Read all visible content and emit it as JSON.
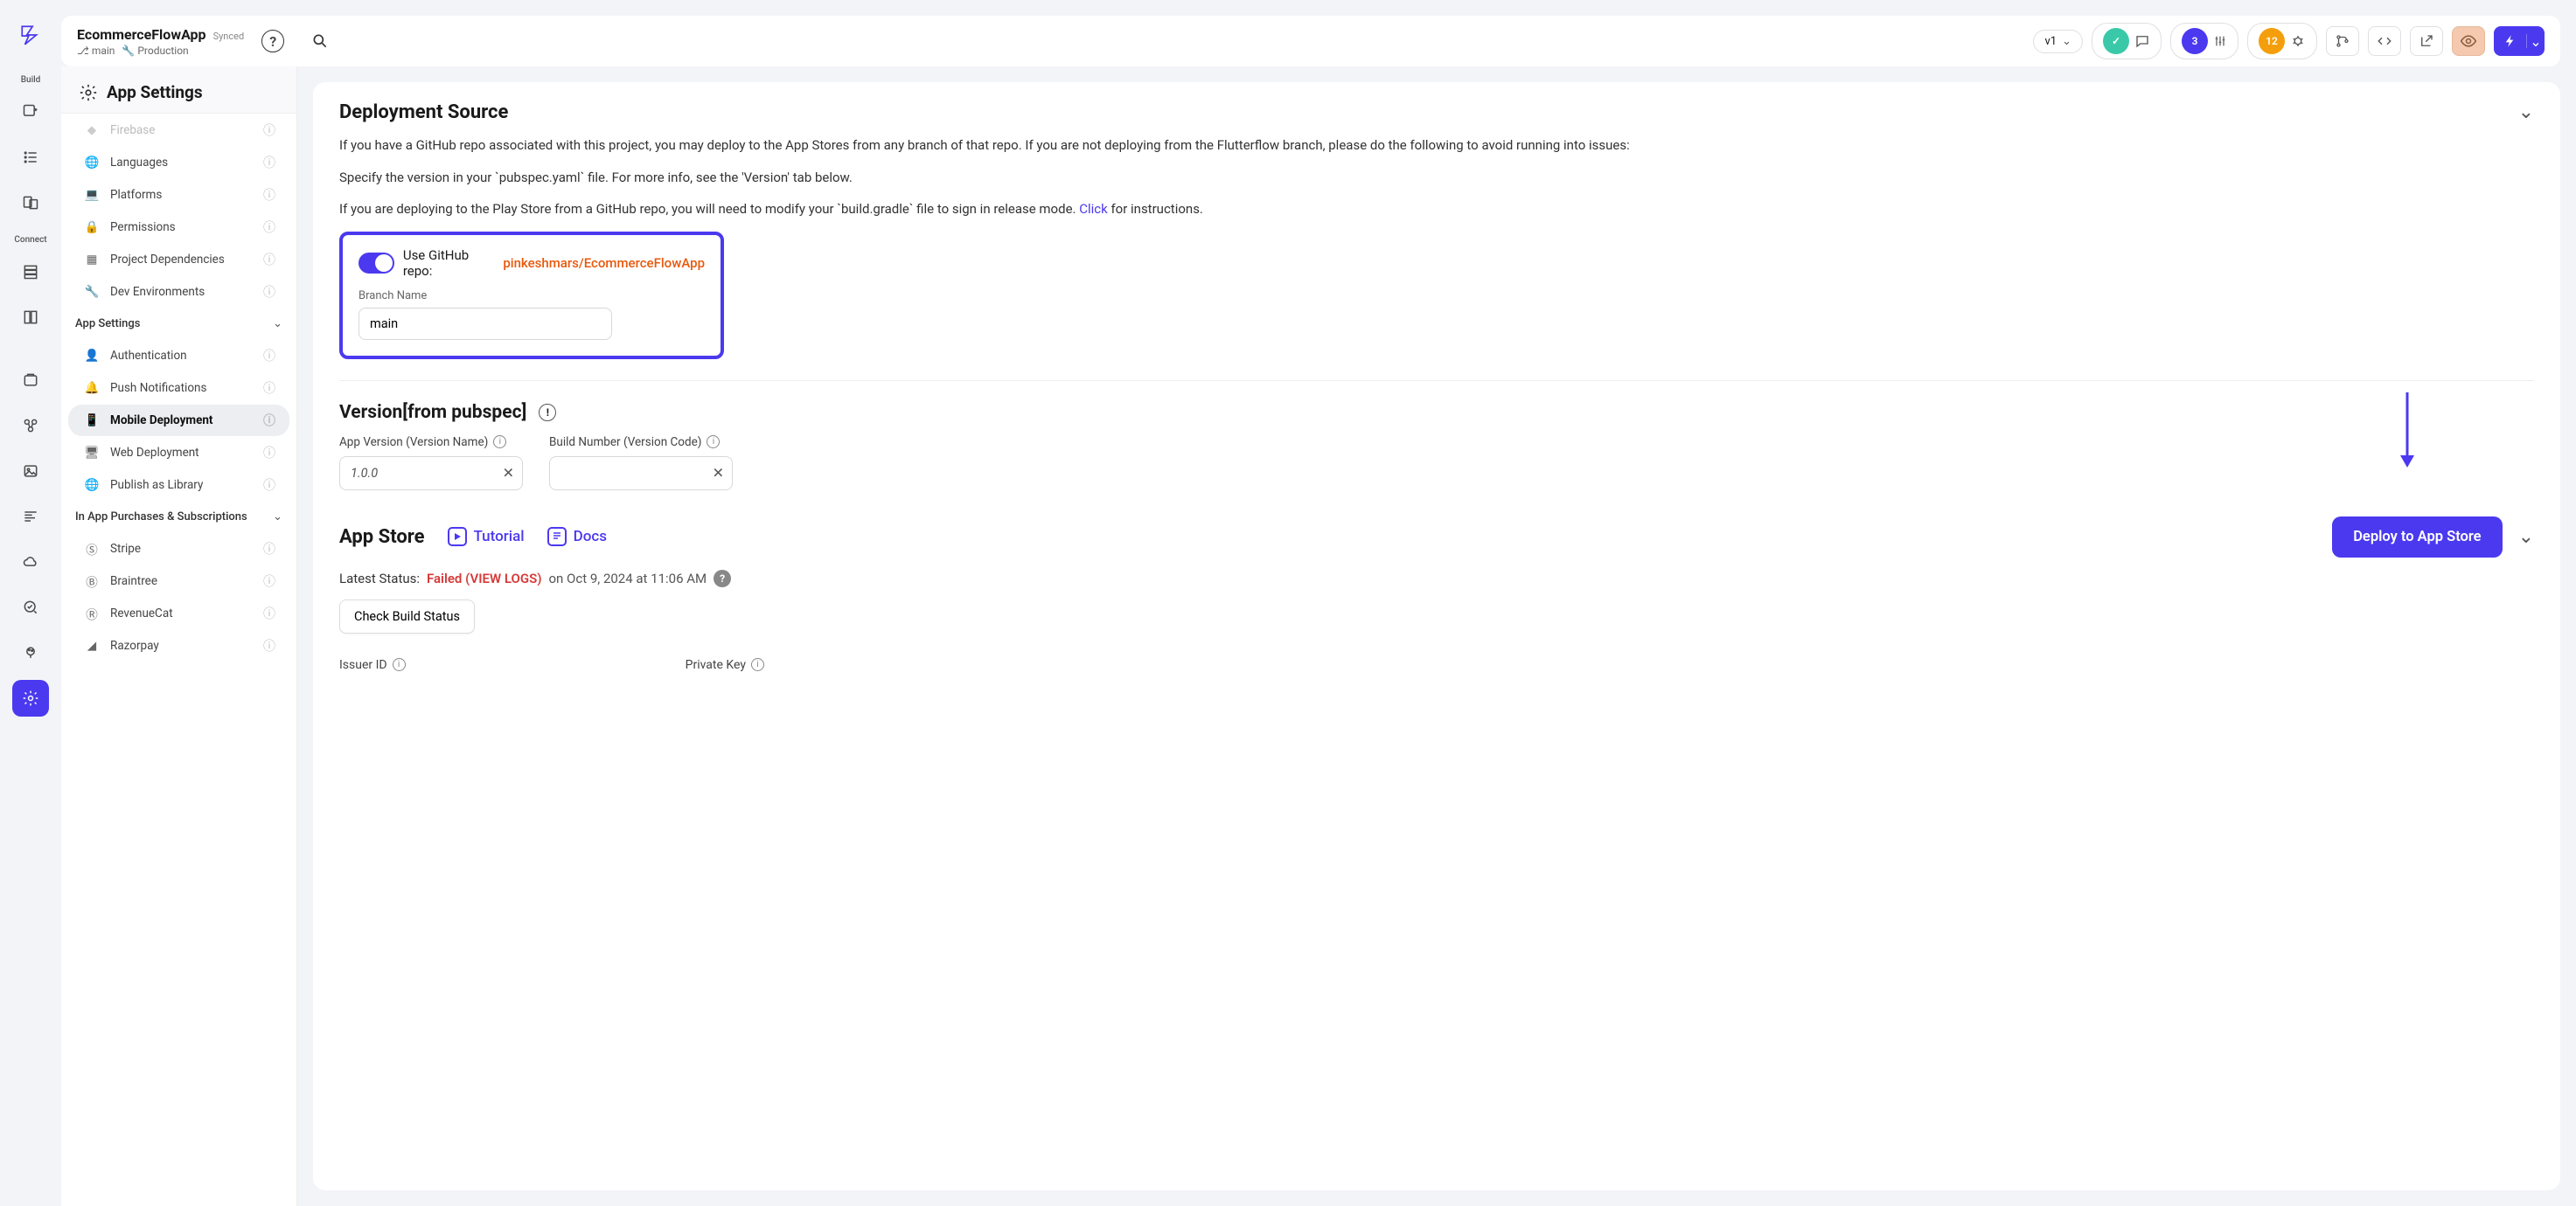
{
  "project": {
    "name": "EcommerceFlowApp",
    "sync": "Synced",
    "branch": "main",
    "env": "Production"
  },
  "topbar": {
    "version": "v1",
    "badge_purple": "3",
    "badge_orange": "12"
  },
  "rail": {
    "build": "Build",
    "connect": "Connect"
  },
  "sidebar": {
    "title": "App Settings",
    "groups": {
      "app_settings": "App Settings",
      "in_app": "In App Purchases & Subscriptions"
    },
    "items": {
      "firebase": "Firebase",
      "languages": "Languages",
      "platforms": "Platforms",
      "permissions": "Permissions",
      "deps": "Project Dependencies",
      "devenv": "Dev Environments",
      "auth": "Authentication",
      "push": "Push Notifications",
      "mobile": "Mobile Deployment",
      "web": "Web Deployment",
      "publib": "Publish as Library",
      "stripe": "Stripe",
      "braintree": "Braintree",
      "revenuecat": "RevenueCat",
      "razorpay": "Razorpay"
    }
  },
  "deployment": {
    "title": "Deployment Source",
    "p1": "If you have a GitHub repo associated with this project, you may deploy to the App Stores from any branch of that repo. If you are not deploying from the Flutterflow branch, please do the following to avoid running into issues:",
    "p2": "Specify the version in your `pubspec.yaml` file. For more info, see the 'Version' tab below.",
    "p3a": "If you are deploying to the Play Store from a GitHub repo, you will need to modify your `build.gradle` file to sign in release mode. ",
    "p3link": "Click",
    "p3b": " for instructions.",
    "toggle_label": "Use GitHub repo:",
    "repo": "pinkeshmars/EcommerceFlowApp",
    "branch_label": "Branch Name",
    "branch_value": "main"
  },
  "version": {
    "title": "Version[from pubspec]",
    "app_version_label": "App Version (Version Name)",
    "app_version_value": "1.0.0",
    "build_number_label": "Build Number (Version Code)",
    "build_number_value": ""
  },
  "appstore": {
    "title": "App Store",
    "tutorial": "Tutorial",
    "docs": "Docs",
    "deploy": "Deploy to App Store",
    "latest_status_label": "Latest Status:",
    "failed": "Failed (VIEW LOGS)",
    "date": "on Oct 9, 2024 at 11:06 AM",
    "check_build": "Check Build Status",
    "issuer_id": "Issuer ID",
    "private_key": "Private Key"
  }
}
